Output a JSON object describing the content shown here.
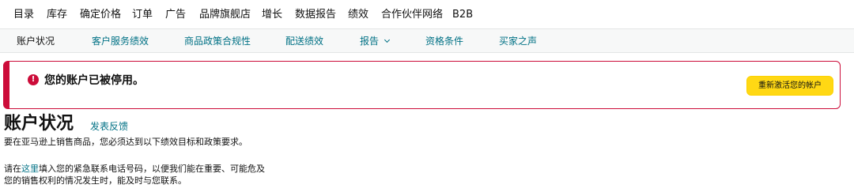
{
  "top_nav": {
    "items": [
      "目录",
      "库存",
      "确定价格",
      "订单",
      "广告",
      "品牌旗舰店",
      "增长",
      "数据报告",
      "绩效",
      "合作伙伴网络",
      "B2B"
    ]
  },
  "sub_nav": {
    "items": [
      "账户状况",
      "客户服务绩效",
      "商品政策合规性",
      "配送绩效",
      "报告",
      "资格条件",
      "买家之声"
    ],
    "active": "账户状况"
  },
  "alert": {
    "icon": "exclamation-icon",
    "icon_glyph": "!",
    "message": "您的账户已被停用。",
    "button_label": "重新激活您的帐户",
    "color": "#cc0c39",
    "button_color": "#ffd814"
  },
  "header": {
    "title": "账户状况",
    "feedback_label": "发表反馈"
  },
  "description": {
    "line1": "要在亚马逊上销售商品，您必须达到以下绩效目标和政策要求。",
    "line2_prefix": "请在",
    "line2_link": "这里",
    "line2_suffix": "填入您的紧急联系电话号码，以便我们能在重要、可能危及您的销售权利的情况发生时，能及时与您联系。"
  },
  "colors": {
    "link": "#007185",
    "text": "#111111"
  }
}
